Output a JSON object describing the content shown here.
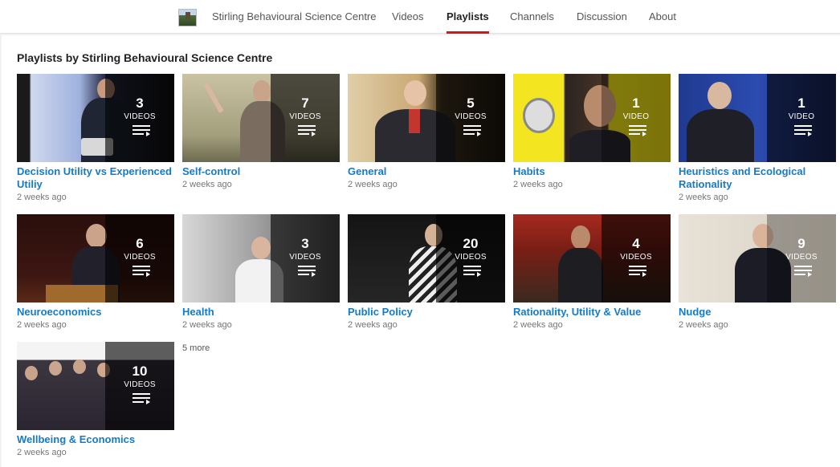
{
  "nav": {
    "channel_name": "Stirling Behavioural Science Centre",
    "tabs": [
      "Videos",
      "Playlists",
      "Channels",
      "Discussion",
      "About"
    ],
    "active_tab": "Playlists"
  },
  "section": {
    "heading": "Playlists by Stirling Behavioural Science Centre"
  },
  "playlists": [
    {
      "count": "3",
      "label": "VIDEOS",
      "title": "Decision Utility vs Experienced Utiliy",
      "age": "2 weeks ago",
      "icon": "playlist-icon"
    },
    {
      "count": "7",
      "label": "VIDEOS",
      "title": "Self-control",
      "age": "2 weeks ago",
      "icon": "playlist-icon"
    },
    {
      "count": "5",
      "label": "VIDEOS",
      "title": "General",
      "age": "2 weeks ago",
      "icon": "playlist-icon"
    },
    {
      "count": "1",
      "label": "VIDEO",
      "title": "Habits",
      "age": "2 weeks ago",
      "icon": "playlist-icon"
    },
    {
      "count": "1",
      "label": "VIDEO",
      "title": "Heuristics and Ecological Rationality",
      "age": "2 weeks ago",
      "icon": "playlist-icon"
    },
    {
      "count": "6",
      "label": "VIDEOS",
      "title": "Neuroeconomics",
      "age": "2 weeks ago",
      "icon": "playlist-icon"
    },
    {
      "count": "3",
      "label": "VIDEOS",
      "title": "Health",
      "age": "2 weeks ago",
      "icon": "playlist-icon"
    },
    {
      "count": "20",
      "label": "VIDEOS",
      "title": "Public Policy",
      "age": "2 weeks ago",
      "icon": "playlist-icon"
    },
    {
      "count": "4",
      "label": "VIDEOS",
      "title": "Rationality, Utility & Value",
      "age": "2 weeks ago",
      "icon": "playlist-icon"
    },
    {
      "count": "9",
      "label": "VIDEOS",
      "title": "Nudge",
      "age": "2 weeks ago",
      "icon": "playlist-icon"
    },
    {
      "count": "10",
      "label": "VIDEOS",
      "title": "Wellbeing & Economics",
      "age": "2 weeks ago",
      "icon": "playlist-icon"
    }
  ],
  "more_link": "5 more"
}
